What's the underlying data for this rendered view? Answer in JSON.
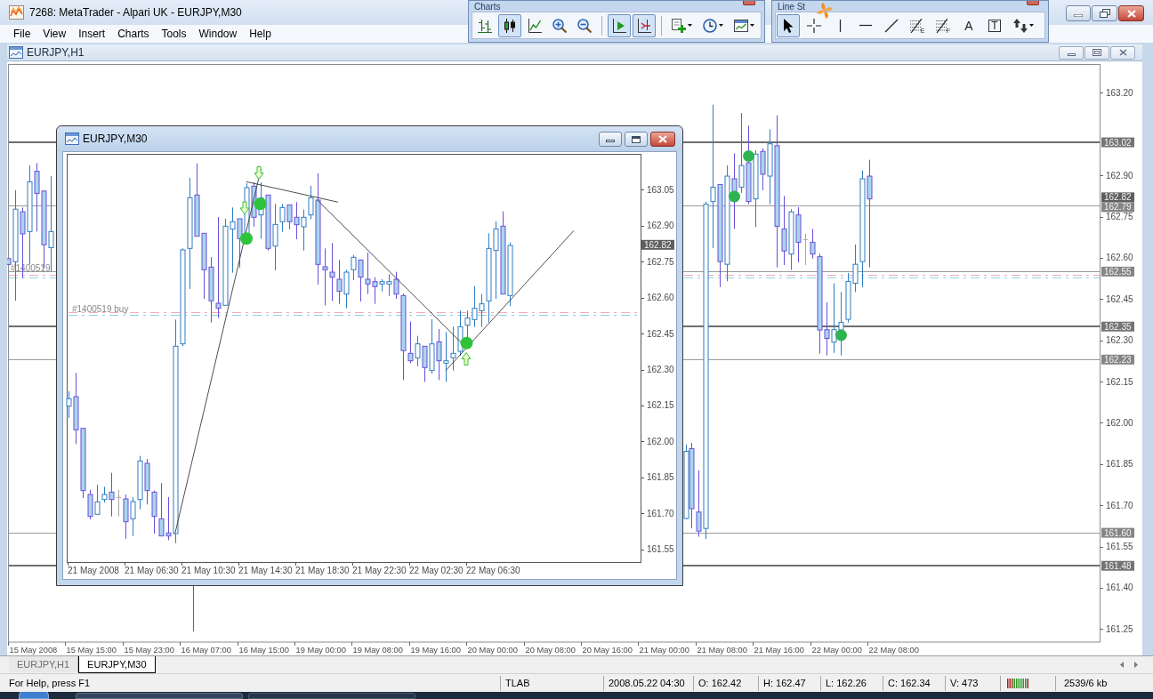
{
  "title_bar": {
    "title": "7268: MetaTrader - Alpari UK - EURJPY,M30"
  },
  "toolbars": [
    {
      "title": "Charts",
      "groups": [
        [
          {
            "kind": "bars",
            "selected": false
          },
          {
            "kind": "candles",
            "selected": true
          },
          {
            "kind": "line",
            "selected": false
          },
          {
            "kind": "zoom_in",
            "selected": false
          },
          {
            "kind": "zoom_out",
            "selected": false
          }
        ],
        [
          {
            "kind": "shift",
            "selected": true
          },
          {
            "kind": "autoscroll",
            "selected": true
          }
        ],
        [
          {
            "kind": "indicators",
            "selected": false
          },
          {
            "kind": "periods",
            "selected": false
          },
          {
            "kind": "templates",
            "selected": false
          }
        ]
      ]
    },
    {
      "title": "Line St",
      "groups": [
        [
          {
            "kind": "cursor",
            "selected": true
          },
          {
            "kind": "crosshair",
            "selected": false
          },
          {
            "kind": "vline",
            "selected": false
          },
          {
            "kind": "hline",
            "selected": false
          },
          {
            "kind": "trendline",
            "selected": false
          },
          {
            "kind": "fibo",
            "label": "E",
            "selected": false
          },
          {
            "kind": "fibo",
            "label": "F",
            "selected": false
          },
          {
            "kind": "text",
            "label": "A",
            "selected": false
          },
          {
            "kind": "textlabel",
            "label": "T",
            "selected": false
          },
          {
            "kind": "arrows",
            "selected": false
          }
        ]
      ]
    }
  ],
  "menu": [
    "File",
    "View",
    "Insert",
    "Charts",
    "Tools",
    "Window",
    "Help"
  ],
  "chart_window": {
    "title": "EURJPY,H1",
    "price_labels": [
      "163.20",
      "162.90",
      "162.75",
      "162.60",
      "162.45",
      "162.30",
      "162.15",
      "162.00",
      "161.85",
      "161.70",
      "161.55",
      "161.40",
      "161.25"
    ],
    "price_tags": [
      {
        "price": "163.02",
        "kind": "thick"
      },
      {
        "price": "162.82",
        "kind": "bid"
      },
      {
        "price": "162.79",
        "kind": "thin"
      },
      {
        "price": "162.55",
        "kind": "thin"
      },
      {
        "price": "162.35",
        "kind": "thick"
      },
      {
        "price": "162.23",
        "kind": "thin"
      },
      {
        "price": "161.60",
        "kind": "thin"
      },
      {
        "price": "161.48",
        "kind": "thick"
      }
    ],
    "time_labels": [
      "15 May 2008",
      "15 May 15:00",
      "15 May 23:00",
      "16 May 07:00",
      "16 May 15:00",
      "19 May 00:00",
      "19 May 08:00",
      "19 May 16:00",
      "20 May 00:00",
      "20 May 08:00",
      "20 May 16:00",
      "21 May 00:00",
      "21 May 08:00",
      "21 May 16:00",
      "22 May 00:00",
      "22 May 08:00"
    ],
    "order_label": "#1400519"
  },
  "inner_window": {
    "title": "EURJPY,M30",
    "price_labels": [
      "163.05",
      "162.90",
      "162.75",
      "162.60",
      "162.45",
      "162.30",
      "162.15",
      "162.00",
      "161.85",
      "161.70",
      "161.55"
    ],
    "price_tags": [
      {
        "price": "162.82",
        "kind": "bid"
      }
    ],
    "time_labels": [
      "21 May 2008",
      "21 May 06:30",
      "21 May 10:30",
      "21 May 14:30",
      "21 May 18:30",
      "21 May 22:30",
      "22 May 02:30",
      "22 May 06:30"
    ],
    "order_label": "#1400519 buy"
  },
  "tabs": [
    {
      "label": "EURJPY,H1",
      "selected": false
    },
    {
      "label": "EURJPY,M30",
      "selected": true
    }
  ],
  "status_bar": {
    "help": "For Help, press F1",
    "profile": "TLAB",
    "time": "2008.05.22 04:30",
    "open": "O: 162.42",
    "high": "H: 162.47",
    "low": "L: 162.26",
    "close": "C: 162.34",
    "volume": "V: 473",
    "traffic": "2539/6 kb"
  }
}
